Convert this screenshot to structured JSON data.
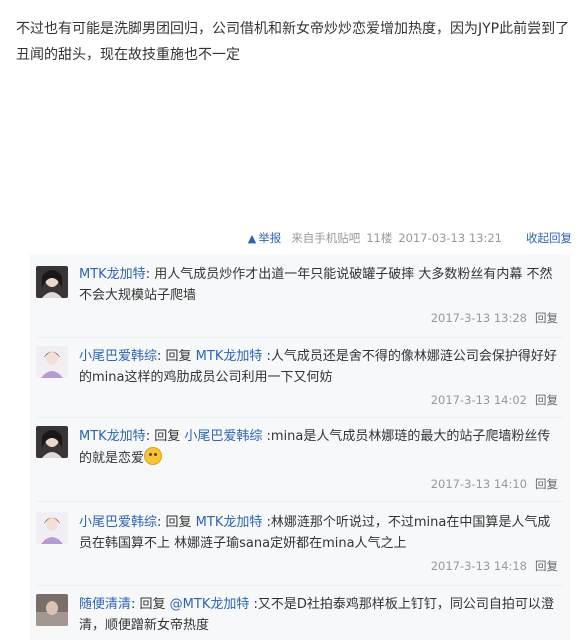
{
  "post": {
    "text": "不过也有可能是洗脚男团回归，公司借机和新女帝炒炒恋爱增加热度，因为JYP此前尝到了丑闻的甜头，现在故技重施也不一定"
  },
  "meta": {
    "report_icon": "triangle-alert-icon",
    "report_label": "举报",
    "source": "来自手机贴吧",
    "floor": "11楼",
    "time": "2017-03-13 13:21",
    "collapse_reply": "收起回复"
  },
  "colors": {
    "link": "#2d64b3",
    "reply_bg": "#f7f8fa",
    "meta_text": "#999999"
  },
  "replies": [
    {
      "user": "MTK龙加特",
      "sep": ": ",
      "reply_word": "",
      "target": "",
      "content": "用人气成员炒作才出道一年只能说破罐子破摔 大多数粉丝有内幕 不然不会大规模站子爬墙",
      "time": "2017-3-13 13:28",
      "reply_btn": "回复"
    },
    {
      "user": "小尾巴爱韩综",
      "sep": ": ",
      "reply_word": "回复 ",
      "target": "MTK龙加特",
      "content": " :人气成员还是舍不得的像林娜涟公司会保护得好好的mina这样的鸡肋成员公司利用一下又何妨",
      "time": "2017-3-13 14:02",
      "reply_btn": "回复"
    },
    {
      "user": "MTK龙加特",
      "sep": ": ",
      "reply_word": "回复 ",
      "target": "小尾巴爱韩综",
      "content": " :mina是人气成员林娜琏的最大的站子爬墙粉丝传的就是恋爱",
      "time": "2017-3-13 14:10",
      "reply_btn": "回复"
    },
    {
      "user": "小尾巴爱韩综",
      "sep": ": ",
      "reply_word": "回复 ",
      "target": "MTK龙加特",
      "content": " :林娜涟那个听说过，不过mina在中国算是人气成员在韩国算不上 林娜涟子瑜sana定妍都在mina人气之上",
      "time": "2017-3-13 14:18",
      "reply_btn": "回复"
    },
    {
      "user": "随便清清",
      "sep": ": ",
      "reply_word": "回复 ",
      "target": "@MTK龙加特",
      "content": " :又不是D社拍泰鸡那样板上钉钉，同公司自拍可以澄清，顺便蹭新女帝热度",
      "time": "",
      "reply_btn": ""
    }
  ]
}
